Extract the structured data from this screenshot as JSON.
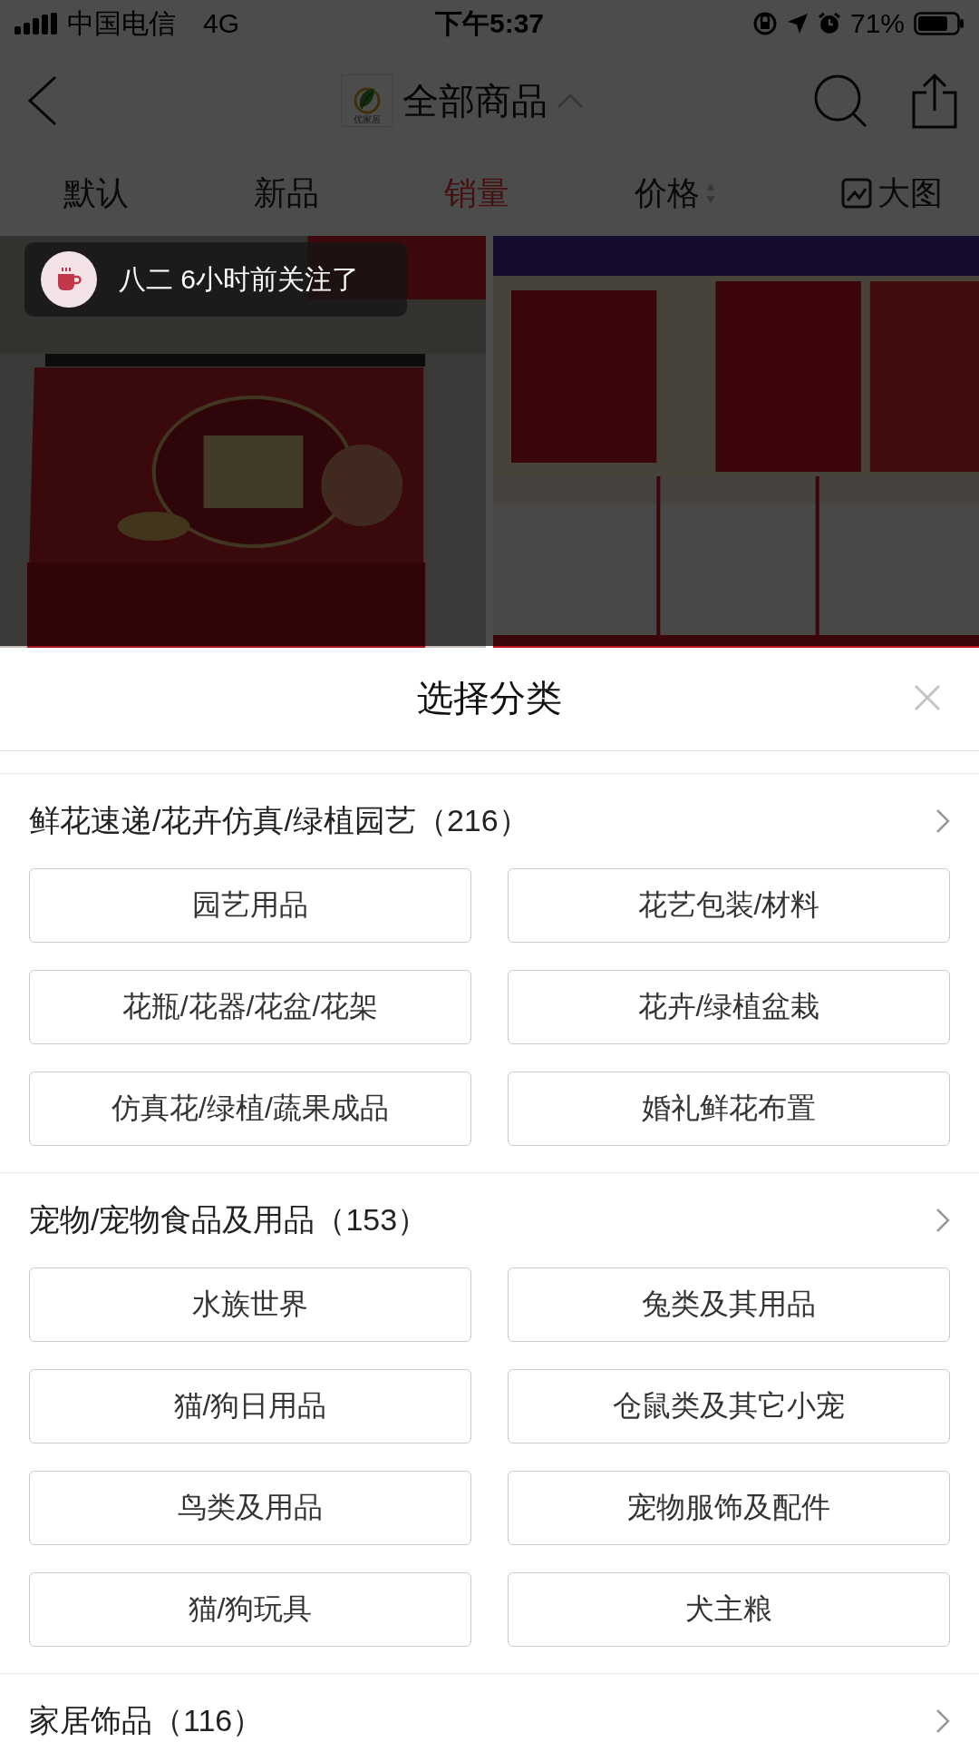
{
  "status_bar": {
    "carrier": "中国电信",
    "network": "4G",
    "time": "下午5:37",
    "battery": "71%"
  },
  "header": {
    "logo_text": "优家居",
    "title": "全部商品"
  },
  "sort_tabs": [
    {
      "label": "默认",
      "selected": false,
      "kind": "plain"
    },
    {
      "label": "新品",
      "selected": false,
      "kind": "plain"
    },
    {
      "label": "销量",
      "selected": true,
      "kind": "plain"
    },
    {
      "label": "价格",
      "selected": false,
      "kind": "sort"
    },
    {
      "label": "大图",
      "selected": false,
      "kind": "view"
    }
  ],
  "toast": {
    "text": "八二 6小时前关注了"
  },
  "sheet": {
    "title": "选择分类",
    "sections": [
      {
        "title": "鲜花速递/花卉仿真/绿植园艺（216）",
        "options": [
          "园艺用品",
          "花艺包装/材料",
          "花瓶/花器/花盆/花架",
          "花卉/绿植盆栽",
          "仿真花/绿植/蔬果成品",
          "婚礼鲜花布置"
        ]
      },
      {
        "title": "宠物/宠物食品及用品（153）",
        "options": [
          "水族世界",
          "兔类及其用品",
          "猫/狗日用品",
          "仓鼠类及其它小宠",
          "鸟类及用品",
          "宠物服饰及配件",
          "猫/狗玩具",
          "犬主粮"
        ]
      },
      {
        "title": "家居饰品（116）"
      }
    ]
  }
}
